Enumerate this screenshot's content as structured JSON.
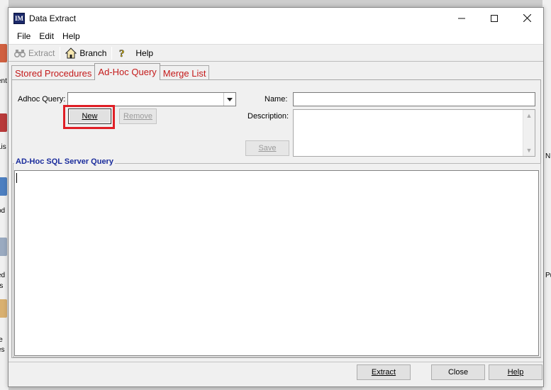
{
  "window": {
    "title": "Data Extract",
    "app_icon": "IM"
  },
  "menu": {
    "items": [
      "File",
      "Edit",
      "Help"
    ]
  },
  "toolbar": {
    "extract_label": "Extract",
    "branch_label": "Branch",
    "help_label": "Help"
  },
  "tabs": [
    {
      "label": "Stored Procedures",
      "active": false
    },
    {
      "label": "Ad-Hoc Query",
      "active": true
    },
    {
      "label": "Merge List",
      "active": false
    }
  ],
  "form": {
    "adhoc_label": "Adhoc Query:",
    "adhoc_value": "",
    "name_label": "Name:",
    "name_value": "",
    "description_label": "Description:",
    "description_value": "",
    "new_button": "New",
    "remove_button": "Remove",
    "save_button": "Save"
  },
  "query_group": {
    "title": "AD-Hoc SQL Server Query",
    "value": ""
  },
  "footer": {
    "extract_button": "Extract",
    "close_button": "Close",
    "help_button": "Help"
  },
  "background": {
    "left_fragments": [
      "ent",
      "Lis",
      "od",
      "ed",
      "rs",
      "le",
      "es"
    ],
    "right_fragments": [
      "N",
      "Pu"
    ]
  },
  "colors": {
    "tab_text": "#c41a1a",
    "group_title": "#1a2c9c",
    "highlight": "#e01f26"
  }
}
